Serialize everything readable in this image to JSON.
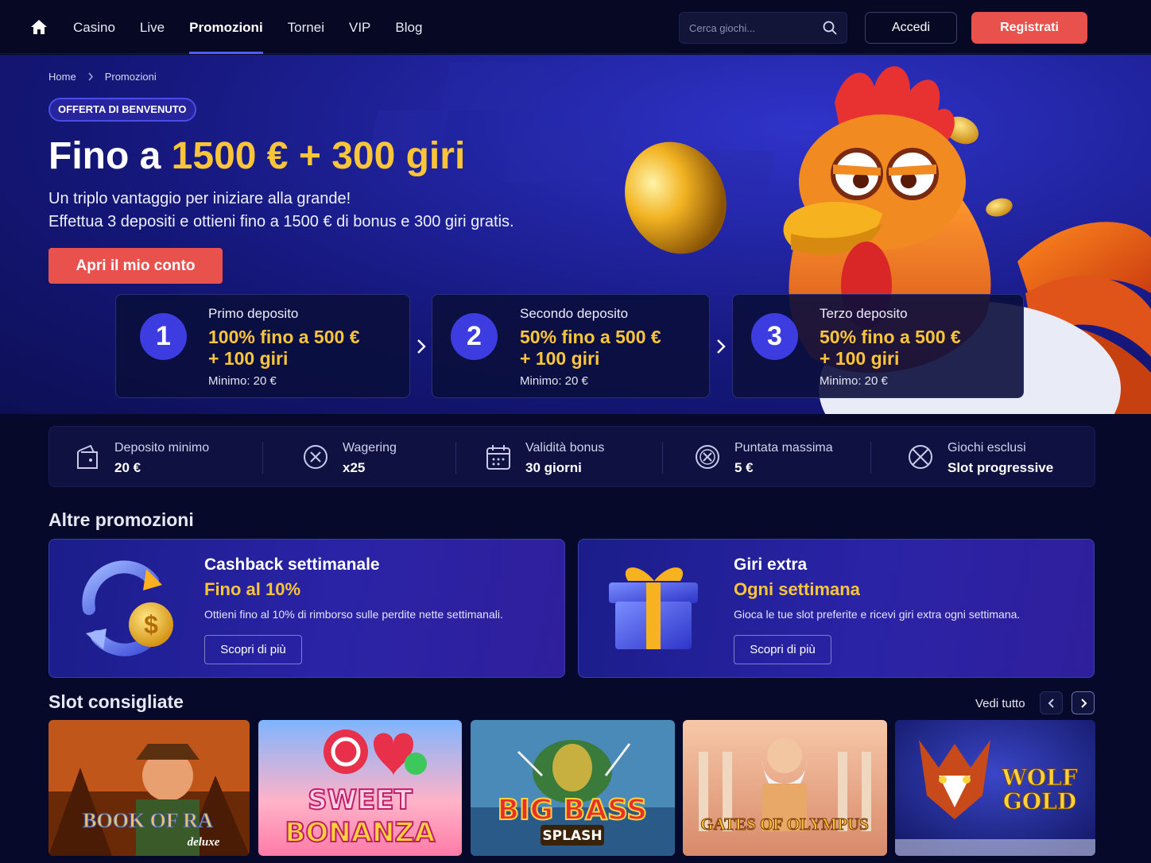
{
  "nav": {
    "home_icon": "home-icon",
    "links": [
      {
        "label": "Casino",
        "active": false
      },
      {
        "label": "Live",
        "active": false
      },
      {
        "label": "Promozioni",
        "active": true
      },
      {
        "label": "Tornei",
        "active": false
      },
      {
        "label": "VIP",
        "active": false
      },
      {
        "label": "Blog",
        "active": false
      }
    ],
    "search_placeholder": "Cerca giochi...",
    "login_label": "Accedi",
    "register_label": "Registrati"
  },
  "hero": {
    "breadcrumb": [
      "Home",
      "Promozioni"
    ],
    "badge": "OFFERTA DI BENVENUTO",
    "title_prefix": "Fino a",
    "title_highlight": "1500 € + 300 giri",
    "subtitle_line1": "Un triplo vantaggio per iniziare alla grande!",
    "subtitle_line2": "Effettua 3 depositi e ottieni fino a 1500 € di bonus e 300 giri gratis.",
    "cta_label": "Apri il mio conto",
    "deposits": [
      {
        "number": "1",
        "title": "Primo deposito",
        "offer_line1": "100% fino a 500 €",
        "offer_line2": "+ 100 giri",
        "minimum": "Minimo: 20 €"
      },
      {
        "number": "2",
        "title": "Secondo deposito",
        "offer_line1": "50% fino a 500 €",
        "offer_line2": "+ 100 giri",
        "minimum": "Minimo: 20 €"
      },
      {
        "number": "3",
        "title": "Terzo deposito",
        "offer_line1": "50% fino a 500 €",
        "offer_line2": "+ 100 giri",
        "minimum": "Minimo: 20 €"
      }
    ]
  },
  "info": [
    {
      "icon": "wallet-icon",
      "label": "Deposito minimo",
      "value": "20 €"
    },
    {
      "icon": "wager-icon",
      "label": "Wagering",
      "value": "x25"
    },
    {
      "icon": "calendar-icon",
      "label": "Validità bonus",
      "value": "30 giorni"
    },
    {
      "icon": "max-bet-icon",
      "label": "Puntata massima",
      "value": "5 €"
    },
    {
      "icon": "excluded-icon",
      "label": "Giochi esclusi",
      "value": "Slot progressive"
    }
  ],
  "other_promos": {
    "title": "Altre promozioni",
    "items": [
      {
        "title": "Cashback settimanale",
        "highlight": "Fino al 10%",
        "description": "Ottieni fino al 10% di rimborso sulle perdite nette settimanali.",
        "button": "Scopri di più",
        "icon": "cashback-coin-icon"
      },
      {
        "title": "Giri extra",
        "highlight": "Ogni settimana",
        "description": "Gioca le tue slot preferite e ricevi giri extra ogni settimana.",
        "button": "Scopri di più",
        "icon": "gift-box-icon"
      }
    ]
  },
  "slots": {
    "title": "Slot consigliate",
    "see_all": "Vedi tutto",
    "items": [
      {
        "name": "BOOK OF RA",
        "tagline": "deluxe"
      },
      {
        "name": "SWEET",
        "tagline": "BONANZA"
      },
      {
        "name": "BIG BASS",
        "tagline": "SPLASH"
      },
      {
        "name": "GATES OF OLYMPUS",
        "tagline": ""
      },
      {
        "name": "WOLF",
        "tagline": "GOLD"
      }
    ]
  },
  "colors": {
    "accent_red": "#e9524c",
    "gold": "#fbc53a",
    "primary_blue": "#3c3ce0",
    "background": "#07092b"
  }
}
